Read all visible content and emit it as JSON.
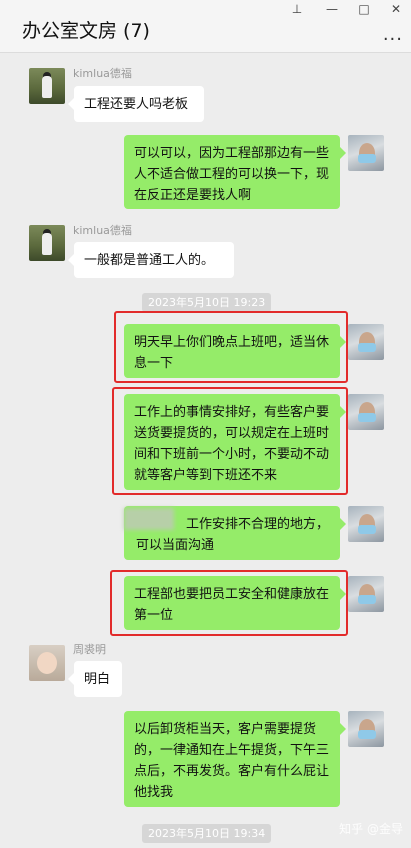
{
  "window": {
    "title": "办公室文房 (7)",
    "controls": {
      "pin": "⊥",
      "minimize": "—",
      "maximize": "□",
      "close": "✕"
    },
    "more_icon": "..."
  },
  "messages": [
    {
      "id": "m1",
      "side": "left",
      "sender": "kimlua德福",
      "text": "工程还要人吗老板"
    },
    {
      "id": "m2",
      "side": "right",
      "text": "可以可以，因为工程部那边有一些人不适合做工程的可以换一下，现在反正还是要找人啊"
    },
    {
      "id": "m3",
      "side": "left",
      "sender": "kimlua德福",
      "text": "一般都是普通工人的。"
    },
    {
      "id": "m4",
      "side": "right",
      "text": "明天早上你们晚点上班吧，适当休息一下"
    },
    {
      "id": "m5",
      "side": "right",
      "text": "工作上的事情安排好，有些客户要送货要提货的，可以规定在上班时间和下班前一个小时，不要动不动就等客户等到下班还不来"
    },
    {
      "id": "m6",
      "side": "right",
      "text": "工作安排不合理的地方，可以当面沟通"
    },
    {
      "id": "m7",
      "side": "right",
      "text": "工程部也要把员工安全和健康放在第一位"
    },
    {
      "id": "m8",
      "side": "left",
      "sender": "周裘明",
      "text": "明白"
    },
    {
      "id": "m9",
      "side": "right",
      "text": "以后卸货柜当天，客户需要提货的，一律通知在上午提货，下午三点后，不再发货。客户有什么屁让他找我"
    }
  ],
  "timestamps": [
    "2023年5月10日 19:23",
    "2023年5月10日 19:34"
  ],
  "watermark": "知乎 @金导",
  "highlight_color": "#e22b2b"
}
